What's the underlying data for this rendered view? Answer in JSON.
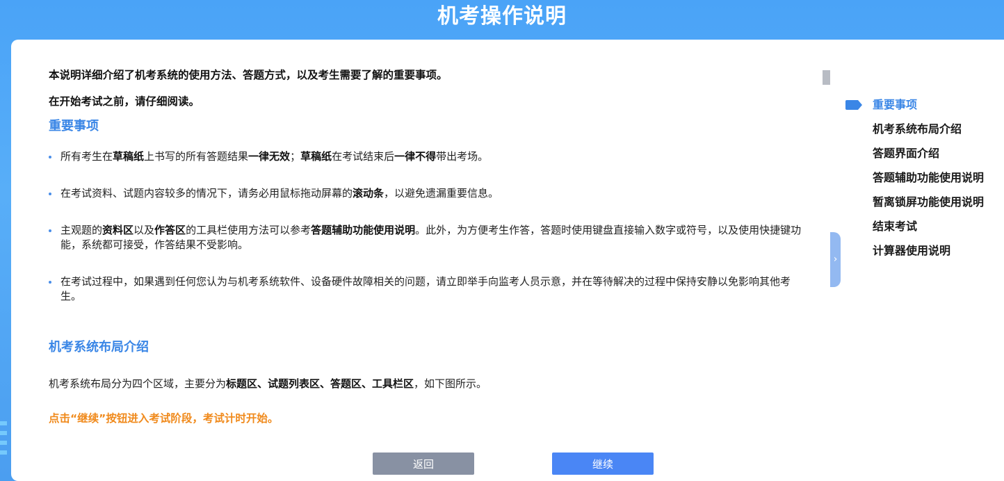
{
  "header": {
    "title": "机考操作说明"
  },
  "intro": {
    "line1": "本说明详细介绍了机考系统的使用方法、答题方式，以及考生需要了解的重要事项。",
    "line2": "在开始考试之前，请仔细阅读。"
  },
  "sections": {
    "important": {
      "title": "重要事项",
      "bullets": [
        [
          {
            "t": "所有考生在"
          },
          {
            "t": "草稿纸",
            "b": true
          },
          {
            "t": "上书写的所有答题结果"
          },
          {
            "t": "一律无效",
            "b": true
          },
          {
            "t": "；"
          },
          {
            "t": "草稿纸",
            "b": true
          },
          {
            "t": "在考试结束后"
          },
          {
            "t": "一律不得",
            "b": true
          },
          {
            "t": "带出考场。"
          }
        ],
        [
          {
            "t": "在考试资料、试题内容较多的情况下，请务必用鼠标拖动屏幕的"
          },
          {
            "t": "滚动条",
            "b": true
          },
          {
            "t": "，以避免遗漏重要信息。"
          }
        ],
        [
          {
            "t": "主观题的"
          },
          {
            "t": "资料区",
            "b": true
          },
          {
            "t": "以及"
          },
          {
            "t": "作答区",
            "b": true
          },
          {
            "t": "的工具栏使用方法可以参考"
          },
          {
            "t": "答题辅助功能使用说明",
            "b": true
          },
          {
            "t": "。此外，为方便考生作答，答题时使用键盘直接输入数字或符号，以及使用快捷键功能，系统都可接受，作答结果不受影响。"
          }
        ],
        [
          {
            "t": "在考试过程中，如果遇到任何您认为与机考系统软件、设备硬件故障相关的问题，请立即举手向监考人员示意，并在等待解决的过程中保持安静以免影响其他考生。"
          }
        ]
      ]
    },
    "layout": {
      "title": "机考系统布局介绍",
      "paragraph": [
        {
          "t": "机考系统布局分为四个区域，主要分为"
        },
        {
          "t": "标题区、试题列表区、答题区、工具栏区",
          "b": true
        },
        {
          "t": "，如下图所示。"
        }
      ]
    }
  },
  "notice": "点击“继续”按钮进入考试阶段，考试计时开始。",
  "toc": {
    "items": [
      "重要事项",
      "机考系统布局介绍",
      "答题界面介绍",
      "答题辅助功能使用说明",
      "暂离锁屏功能使用说明",
      "结束考试",
      "计算器使用说明"
    ],
    "active_index": 0
  },
  "side_toggle": {
    "icon": "chevron-right-icon",
    "glyph": "›"
  },
  "buttons": {
    "back": "返回",
    "continue": "继续"
  },
  "colors": {
    "accent": "#3a86e6",
    "notice": "#f08a1c",
    "back_button": "#8891a3",
    "continue_button": "#4a86f5",
    "header_bg": "#4aa3f7"
  }
}
